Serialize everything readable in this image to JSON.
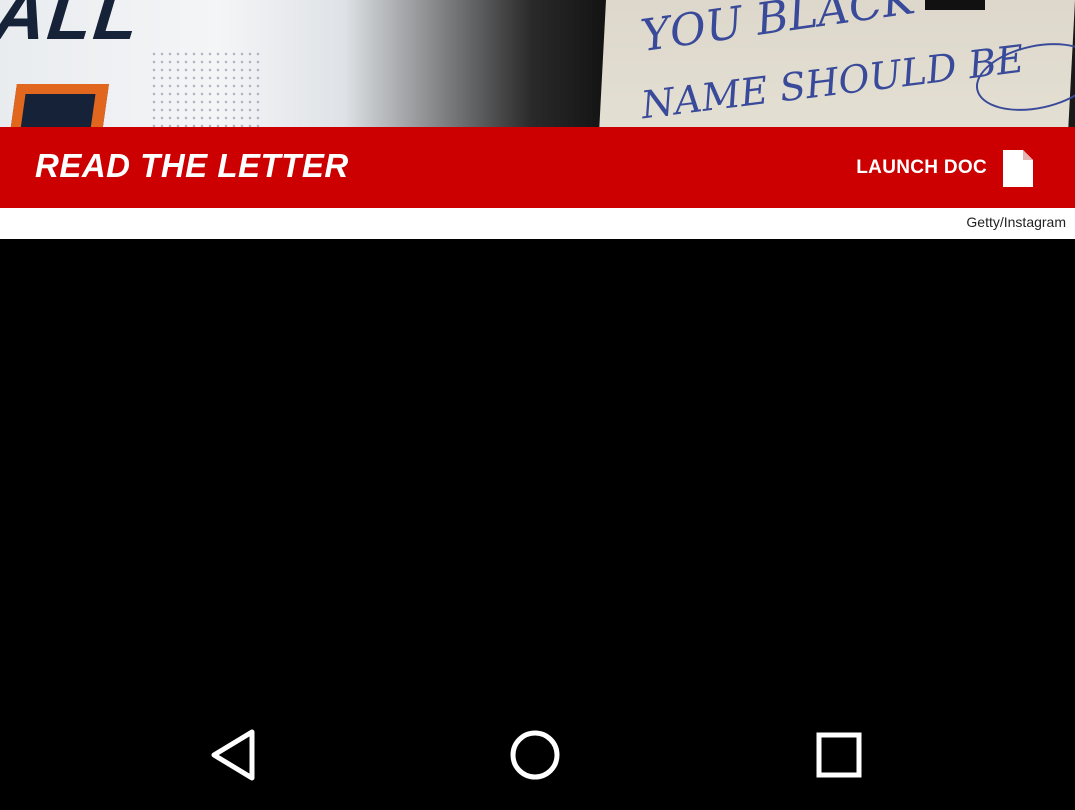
{
  "banner": {
    "title": "READ THE LETTER",
    "launch_label": "LAUNCH DOC",
    "background_color": "#cc0000"
  },
  "image": {
    "credit": "Getty/Instagram",
    "jersey_text": "ALL",
    "letter_line_1": "YOU BLACK",
    "letter_line_2": "NAME SHOULD BE"
  },
  "icons": {
    "launch": "document-icon",
    "back": "back-triangle-icon",
    "home": "home-circle-icon",
    "recent": "recent-apps-square-icon"
  }
}
